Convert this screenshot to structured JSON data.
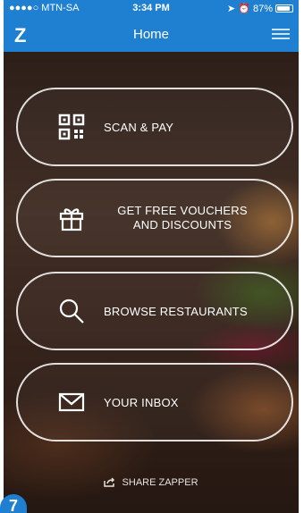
{
  "status_bar": {
    "carrier": "●●●●○ MTN-SA",
    "time": "3:34 PM",
    "battery": "87%",
    "battery_level": 0.87
  },
  "nav": {
    "logo": "Z",
    "title": "Home"
  },
  "actions": [
    {
      "label": "SCAN & PAY",
      "icon": "qr-code-icon"
    },
    {
      "label_line1": "GET FREE VOUCHERS",
      "label_line2": "AND DISCOUNTS",
      "icon": "gift-icon"
    },
    {
      "label": "BROWSE RESTAURANTS",
      "icon": "search-icon"
    },
    {
      "label": "YOUR INBOX",
      "icon": "envelope-icon"
    }
  ],
  "share": {
    "label": "SHARE ZAPPER",
    "icon": "share-icon"
  },
  "corner_badge": "7",
  "colors": {
    "brand": "#1f7fd0",
    "pill_border": "#ffffff"
  }
}
